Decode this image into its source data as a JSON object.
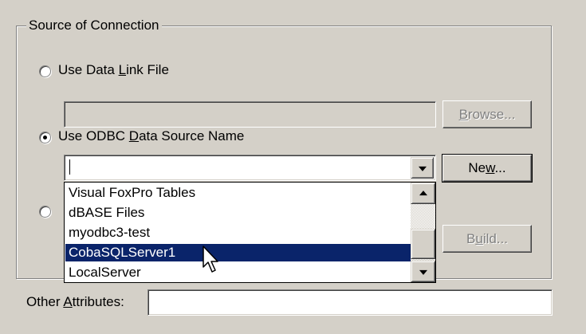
{
  "groupbox": {
    "title": "Source of Connection"
  },
  "options": {
    "data_link": {
      "pre": "Use Data ",
      "accel": "L",
      "post": "ink File",
      "selected": false
    },
    "odbc": {
      "pre": "Use ODBC ",
      "accel": "D",
      "post": "ata Source Name",
      "selected": true
    },
    "connection_string": {
      "selected": false
    }
  },
  "buttons": {
    "browse": {
      "pre": "",
      "accel": "B",
      "post": "rowse...",
      "enabled": false
    },
    "new": {
      "pre": "Ne",
      "accel": "w",
      "post": "...",
      "enabled": true
    },
    "build": {
      "pre": "B",
      "accel": "u",
      "post": "ild...",
      "enabled": false
    }
  },
  "dsn_combo": {
    "value": ""
  },
  "data_link_field": {
    "value": ""
  },
  "dropdown": {
    "items": [
      "Visual FoxPro Tables",
      "dBASE Files",
      "myodbc3-test",
      "CobaSQLServer1",
      "LocalServer"
    ],
    "selected_index": 3
  },
  "other_attributes": {
    "pre": "Other ",
    "accel": "A",
    "post": "ttributes:",
    "value": ""
  },
  "colors": {
    "face": "#d4d0c8",
    "highlight": "#0a246a",
    "shadow": "#808080"
  },
  "icons": {
    "cursor": "arrow-cursor-icon"
  }
}
